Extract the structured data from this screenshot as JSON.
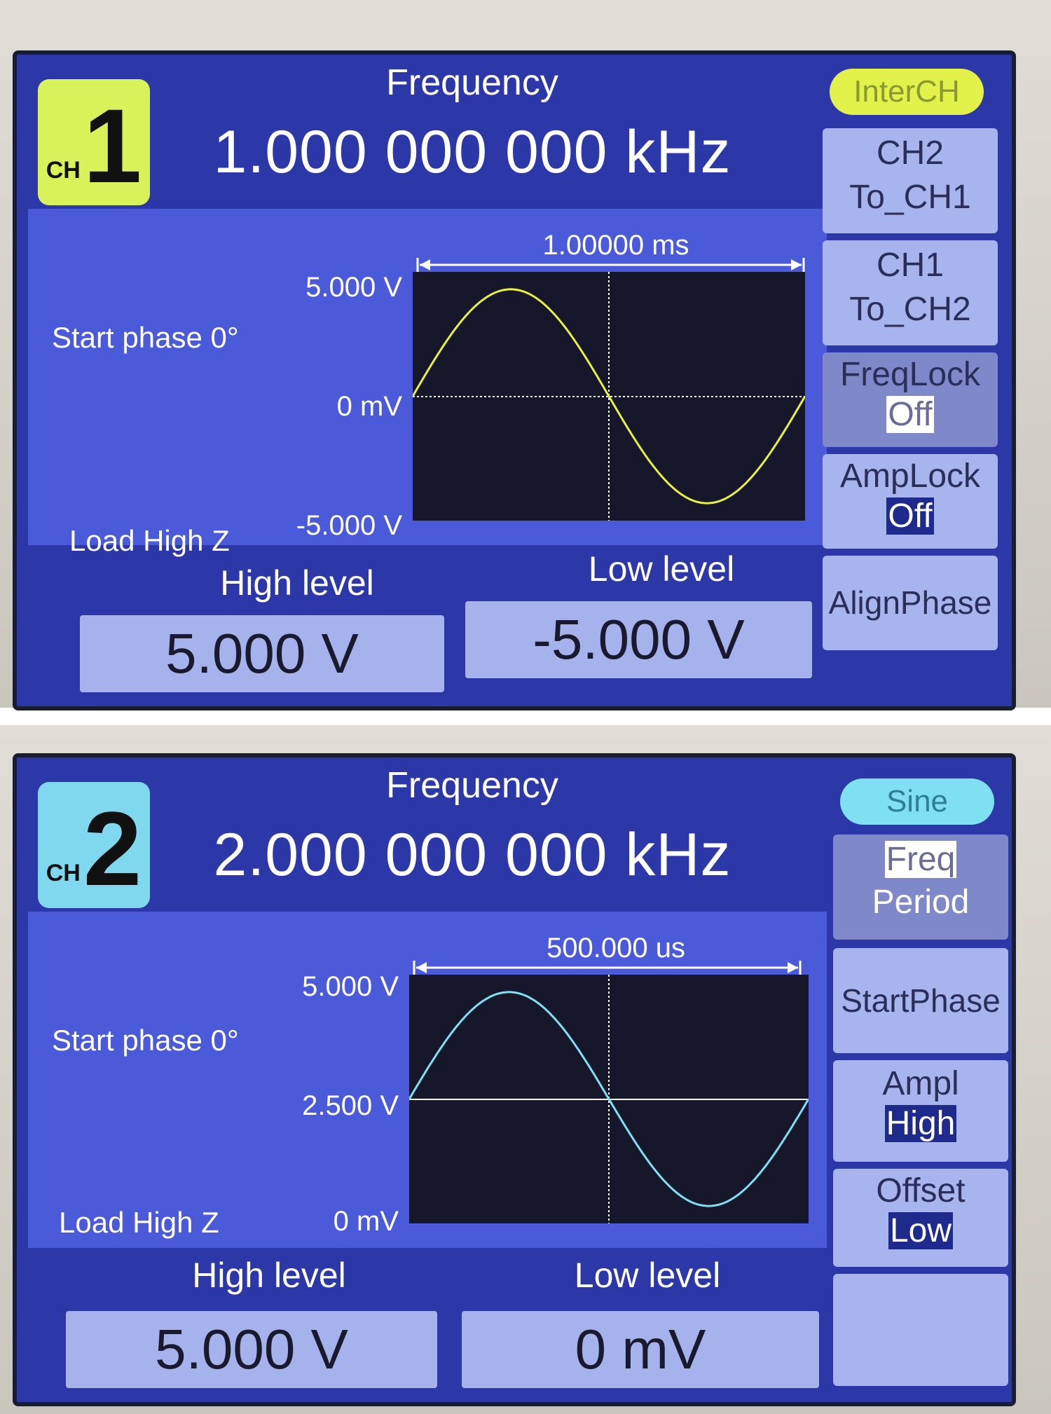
{
  "ch1": {
    "badge_prefix": "CH",
    "badge_number": "1",
    "freq_label": "Frequency",
    "freq_value": "1.000 000 000 kHz",
    "period": "1.00000 ms",
    "y_top": "5.000 V",
    "y_mid": "0 mV",
    "y_bot": "-5.000 V",
    "start_phase": "Start phase 0°",
    "load": "Load High Z",
    "high_label": "High level",
    "low_label": "Low level",
    "high_value": "5.000 V",
    "low_value": "-5.000 V",
    "wave_color": "#e8f040",
    "badge_color": "#d9f25a",
    "side": {
      "pill": "InterCH",
      "btn1_l1": "CH2",
      "btn1_l2": "To_CH1",
      "btn2_l1": "CH1",
      "btn2_l2": "To_CH2",
      "btn3_l1": "FreqLock",
      "btn3_l2": "Off",
      "btn4_l1": "AmpLock",
      "btn4_l2": "Off",
      "btn5": "AlignPhase"
    }
  },
  "ch2": {
    "badge_prefix": "CH",
    "badge_number": "2",
    "freq_label": "Frequency",
    "freq_value": "2.000 000 000 kHz",
    "period": "500.000 us",
    "y_top": "5.000 V",
    "y_mid": "2.500 V",
    "y_bot": "0 mV",
    "start_phase": "Start phase 0°",
    "load": "Load High Z",
    "high_label": "High level",
    "low_label": "Low level",
    "high_value": "5.000 V",
    "low_value": "0 mV",
    "wave_color": "#7fe0f4",
    "badge_color": "#7fd8ee",
    "side": {
      "pill": "Sine",
      "btn1_l1": "Freq",
      "btn1_l2": "Period",
      "btn2": "StartPhase",
      "btn3_l1": "Ampl",
      "btn3_l2": "High",
      "btn4_l1": "Offset",
      "btn4_l2": "Low",
      "btn5": ""
    }
  }
}
